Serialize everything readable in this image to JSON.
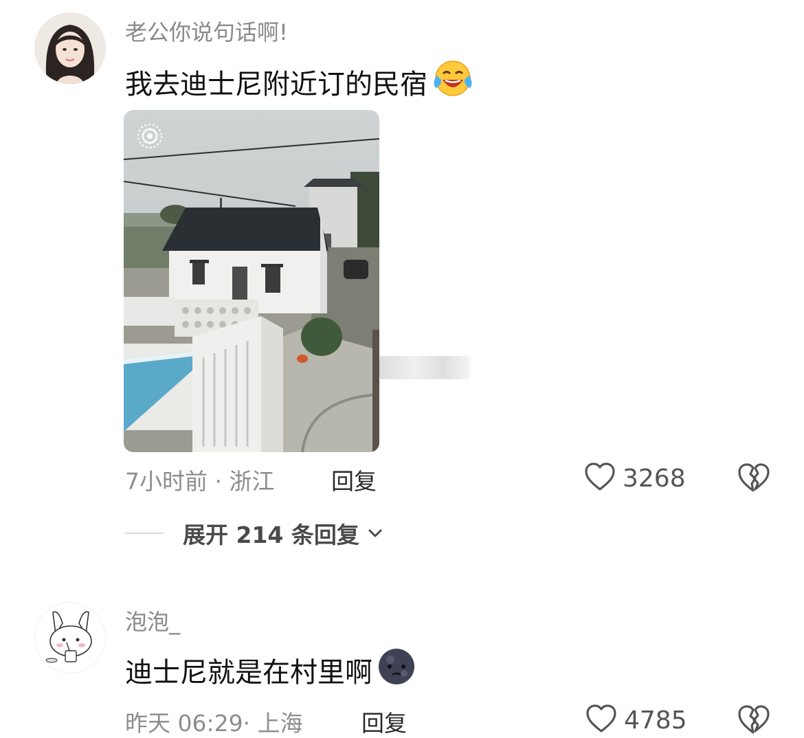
{
  "comments": [
    {
      "username": "老公你说句话啊!",
      "text": "我去迪士尼附近订的民宿",
      "emoji": "laughing-crying-emoji",
      "has_image": true,
      "image_subject": "house-photo",
      "time_location": "7小时前 · 浙江",
      "reply_label": "回复",
      "like_count": "3268",
      "expand_label": "展开 214 条回复"
    },
    {
      "username": "泡泡_",
      "text": "迪士尼就是在村里啊",
      "emoji": "dark-moon-face-emoji",
      "time_location": "昨天 06:29· 上海",
      "reply_label": "回复",
      "like_count": "4785"
    }
  ],
  "colors": {
    "text_primary": "#111111",
    "text_secondary": "#8d8d8d",
    "icon": "#555555"
  },
  "icons": [
    "heart-outline-icon",
    "broken-heart-icon",
    "chevron-down-icon",
    "live-photo-icon"
  ]
}
